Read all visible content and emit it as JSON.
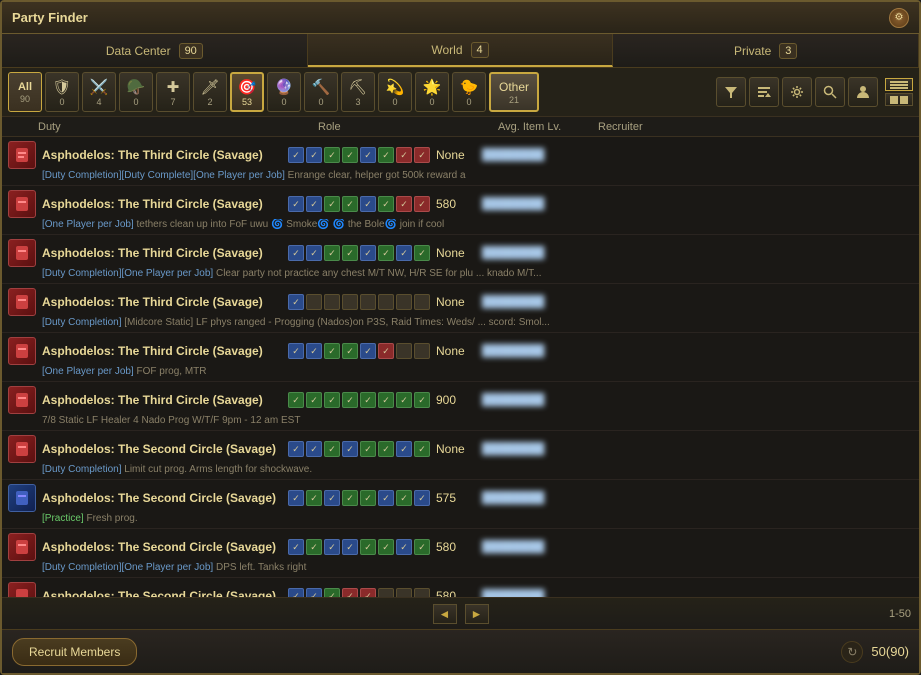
{
  "window": {
    "title": "Party Finder"
  },
  "tabs": [
    {
      "id": "data-center",
      "label": "Data Center",
      "count": "90",
      "active": false
    },
    {
      "id": "world",
      "label": "World",
      "count": "4",
      "active": true
    },
    {
      "id": "private",
      "label": "Private",
      "count": "3",
      "active": false
    }
  ],
  "filters": {
    "all_label": "All",
    "all_count": "90",
    "icons": [
      {
        "name": "tank",
        "emoji": "🛡",
        "count": "0",
        "color": "#3a6aaa"
      },
      {
        "name": "warrior",
        "emoji": "⚔",
        "count": "4",
        "color": "#8a3a3a"
      },
      {
        "name": "paladin",
        "emoji": "🪖",
        "count": "0",
        "color": "#8a7a3a"
      },
      {
        "name": "healer",
        "emoji": "✚",
        "count": "7",
        "color": "#3a8a3a"
      },
      {
        "name": "melee",
        "emoji": "🗡",
        "count": "2",
        "color": "#8a3a3a"
      },
      {
        "name": "ranged",
        "emoji": "🏹",
        "count": "53",
        "color": "#8a5a3a",
        "active": true
      },
      {
        "name": "caster",
        "emoji": "🔮",
        "count": "0",
        "color": "#5a3a8a"
      },
      {
        "name": "craft",
        "emoji": "🔨",
        "count": "0",
        "color": "#6a6a3a"
      },
      {
        "name": "gather",
        "emoji": "⛏",
        "count": "3",
        "color": "#3a6a6a"
      },
      {
        "name": "special1",
        "emoji": "💎",
        "count": "0",
        "color": "#6a4a3a"
      },
      {
        "name": "special2",
        "emoji": "🌟",
        "count": "0",
        "color": "#8a8a3a"
      },
      {
        "name": "chocobo",
        "emoji": "🐣",
        "count": "0",
        "color": "#8a7a2a"
      }
    ],
    "other_label": "Other",
    "other_count": "21"
  },
  "columns": {
    "duty": "Duty",
    "role": "Role",
    "avg_item_lv": "Avg. Item Lv.",
    "recruiter": "Recruiter"
  },
  "listings": [
    {
      "id": 1,
      "duty": "Asphodelos: The Third Circle (Savage)",
      "tags": "[Duty Completion][Duty Complete][One Player per Job]",
      "desc": "Enrange clear, helper got 500k reward a",
      "slots": [
        "blue",
        "blue",
        "green",
        "green",
        "blue",
        "green",
        "red",
        "red"
      ],
      "ilvl": "None",
      "recruiter": "Recruiter1",
      "icon_type": "red"
    },
    {
      "id": 2,
      "duty": "Asphodelos: The Third Circle (Savage)",
      "tags": "[One Player per Job]",
      "desc": "tethers clean up into FoF uwu 🌀 Smoke🌀 🌀 the Bole🌀 join if cool",
      "slots": [
        "blue",
        "blue",
        "green",
        "green",
        "blue",
        "green",
        "red",
        "red"
      ],
      "ilvl": "580",
      "recruiter": "Recruiter2",
      "icon_type": "red"
    },
    {
      "id": 3,
      "duty": "Asphodelos: The Third Circle (Savage)",
      "tags": "[Duty Completion][One Player per Job]",
      "desc": "Clear party not practice any chest M/T NW, H/R SE for plu ... knado M/T...",
      "slots": [
        "blue",
        "blue",
        "green",
        "green",
        "blue",
        "green",
        "blue",
        "green"
      ],
      "ilvl": "None",
      "recruiter": "Recruiter3",
      "icon_type": "red"
    },
    {
      "id": 4,
      "duty": "Asphodelos: The Third Circle (Savage)",
      "tags": "[Duty Completion]",
      "desc": "[Midcore Static] LF phys ranged - Progging (Nados)on P3S, Raid Times: Weds/ ... scord: Smol...",
      "slots": [
        "blue",
        "empty",
        "empty",
        "empty",
        "empty",
        "empty",
        "empty",
        "empty"
      ],
      "ilvl": "None",
      "recruiter": "Recruiter4",
      "icon_type": "red"
    },
    {
      "id": 5,
      "duty": "Asphodelos: The Third Circle (Savage)",
      "tags": "[One Player per Job]",
      "desc": "FOF prog, MTR",
      "slots": [
        "blue",
        "blue",
        "green",
        "green",
        "blue",
        "red",
        "empty",
        "empty"
      ],
      "ilvl": "None",
      "recruiter": "Recruiter5",
      "icon_type": "red"
    },
    {
      "id": 6,
      "duty": "Asphodelos: The Third Circle (Savage)",
      "tags": "",
      "desc": "7/8 Static LF Healer 4 Nado Prog   W/T/F 9pm - 12 am EST",
      "slots": [
        "green",
        "green",
        "green",
        "green",
        "green",
        "green",
        "green",
        "green"
      ],
      "ilvl": "900",
      "recruiter": "Recruiter6",
      "icon_type": "red"
    },
    {
      "id": 7,
      "duty": "Asphodelos: The Second Circle (Savage)",
      "tags": "[Duty Completion]",
      "desc": "Limit cut prog. Arms length for shockwave.",
      "slots": [
        "blue",
        "blue",
        "green",
        "blue",
        "green",
        "green",
        "blue",
        "green"
      ],
      "ilvl": "None",
      "recruiter": "Recruiter7",
      "icon_type": "red"
    },
    {
      "id": 8,
      "duty": "Asphodelos: The Second Circle (Savage)",
      "tags": "[Practice]",
      "desc": "Fresh prog.",
      "slots": [
        "blue",
        "green",
        "blue",
        "green",
        "green",
        "blue",
        "green",
        "blue"
      ],
      "ilvl": "575",
      "recruiter": "Recruiter8",
      "icon_type": "blue"
    },
    {
      "id": 9,
      "duty": "Asphodelos: The Second Circle (Savage)",
      "tags": "[Duty Completion][One Player per Job]",
      "desc": "DPS left. Tanks right",
      "slots": [
        "blue",
        "green",
        "blue",
        "blue",
        "green",
        "green",
        "blue",
        "green"
      ],
      "ilvl": "580",
      "recruiter": "Recruiter9",
      "icon_type": "red"
    },
    {
      "id": 10,
      "duty": "Asphodelos: The Second Circle (Savage)",
      "tags": "",
      "desc": "",
      "slots": [
        "blue",
        "blue",
        "green",
        "green",
        "blue",
        "red",
        "empty",
        "empty"
      ],
      "ilvl": "580",
      "recruiter": "Recruiter10",
      "icon_type": "red"
    }
  ],
  "footer": {
    "prev_label": "◄",
    "next_label": "►",
    "page_info": "1-50"
  },
  "bottom": {
    "recruit_label": "Recruit Members",
    "count_display": "50(90)"
  }
}
